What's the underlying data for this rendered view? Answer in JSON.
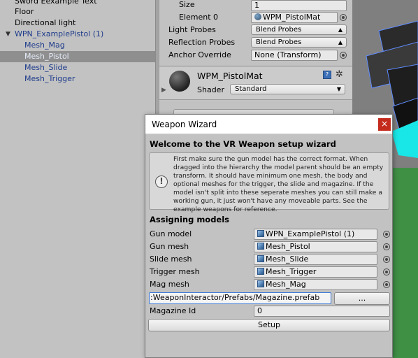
{
  "hierarchy": {
    "items": [
      {
        "label": "Sword Eexample Text",
        "indent": 1
      },
      {
        "label": "Floor",
        "indent": 1
      },
      {
        "label": "Directional light",
        "indent": 1
      },
      {
        "label": "WPN_ExamplePistol (1)",
        "indent": 0
      },
      {
        "label": "Mesh_Mag",
        "indent": 2
      },
      {
        "label": "Mesh_Pistol",
        "indent": 2
      },
      {
        "label": "Mesh_Slide",
        "indent": 2
      },
      {
        "label": "Mesh_Trigger",
        "indent": 2
      }
    ],
    "expand_arrow": "▼"
  },
  "inspector": {
    "size_label": "Size",
    "size_value": "1",
    "element0_label": "Element 0",
    "element0_value": "WPM_PistolMat",
    "light_probes_label": "Light Probes",
    "light_probes_value": "Blend Probes",
    "reflection_probes_label": "Reflection Probes",
    "reflection_probes_value": "Blend Probes",
    "anchor_override_label": "Anchor Override",
    "anchor_override_value": "None (Transform)",
    "material_name": "WPM_PistolMat",
    "shader_label": "Shader",
    "shader_value": "Standard"
  },
  "wizard": {
    "title": "Weapon Wizard",
    "close_label": "×",
    "heading": "Welcome to the VR Weapon setup wizard",
    "help_text": "First make sure the gun model has the correct format. When dragged into the hierarchy the model parent should be an empty transform. It should have minimum one mesh, the body and optional meshes for the trigger, the slide and magazine. If the model isn't split into these seperate meshes you can still make a working gun, it just won't have any moveable parts. See the example weapons for reference.",
    "help_icon": "!",
    "section_heading": "Assigning models",
    "fields": [
      {
        "label": "Gun model",
        "value": "WPN_ExamplePistol (1)"
      },
      {
        "label": "Gun mesh",
        "value": "Mesh_Pistol"
      },
      {
        "label": "Slide mesh",
        "value": "Mesh_Slide"
      },
      {
        "label": "Trigger mesh",
        "value": "Mesh_Trigger"
      },
      {
        "label": "Mag mesh",
        "value": "Mesh_Mag"
      }
    ],
    "path_value": ":WeaponInteractor/Prefabs/Magazine.prefab",
    "browse_label": "...",
    "magazine_id_label": "Magazine Id",
    "magazine_id_value": "0",
    "setup_label": "Setup"
  },
  "colors": {
    "prefab_text": "#1e3c8c",
    "selection": "#8f8f8f",
    "close_button": "#c42b1c",
    "scene_cyan": "#19e6e6",
    "scene_green": "#3f8f45"
  }
}
